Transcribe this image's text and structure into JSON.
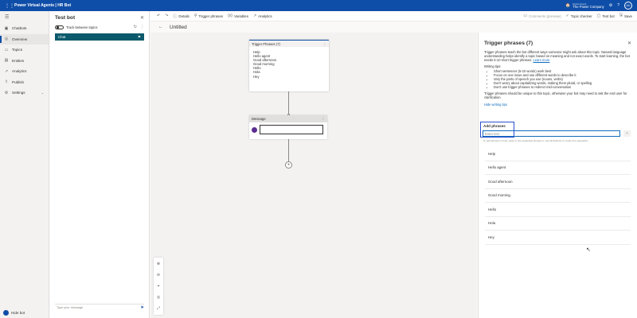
{
  "header": {
    "app_title": "Power Virtual Agents | HR Bot",
    "env_label": "Environment",
    "env_name": "The Power Company",
    "user_initials": "AU"
  },
  "nav": {
    "items": [
      {
        "label": "Chatbots",
        "icon": "bot-icon"
      },
      {
        "label": "Overview",
        "icon": "overview-icon",
        "active": true
      },
      {
        "label": "Topics",
        "icon": "topics-icon"
      },
      {
        "label": "Entities",
        "icon": "entities-icon"
      },
      {
        "label": "Analytics",
        "icon": "analytics-icon"
      },
      {
        "label": "Publish",
        "icon": "publish-icon"
      },
      {
        "label": "Settings",
        "icon": "settings-icon"
      }
    ],
    "hide_bot": "Hide bot"
  },
  "test_panel": {
    "title": "Test bot",
    "track_label": "Track between topics",
    "chat_label": "Chat",
    "input_placeholder": "Type your message"
  },
  "toolbar": {
    "details": "Details",
    "trigger_phrases": "Trigger phrases",
    "variables": "Variables",
    "analytics": "Analytics",
    "comments": "Comments (preview)",
    "topic_checker": "Topic checker",
    "test_bot": "Test bot",
    "save": "Save"
  },
  "canvas": {
    "title": "Untitled",
    "trigger_card_title": "Trigger Phrases (7)",
    "trigger_phrases": [
      "Help",
      "Hello agent",
      "Good afternoon",
      "Good morning",
      "Hello",
      "Hola",
      "Hey"
    ],
    "message_card_title": "Message"
  },
  "right_panel": {
    "title": "Trigger phrases (7)",
    "description": "Trigger phrases teach the bot different ways someone might ask about this topic. Natural language understanding helps identify a topic based on meaning and not exact words. To start learning, the bot needs 5-10 short trigger phrases.",
    "learn_more": "Learn more",
    "tips_heading": "Writing tips:",
    "tips": [
      "Short sentences (5-10 words) work best",
      "Focus on one issue and use different words to describe it",
      "Vary the parts of speech you use (nouns, verbs)",
      "Don't worry about capitalizing words, making them plural, or spelling",
      "Don't use trigger phrases to redirect mid-conversation"
    ],
    "unique_note": "Trigger phrases should be unique to this topic, otherwise your bot may need to ask the end user for clarification.",
    "hide_tips": "Hide writing tips",
    "add_label": "Add phrases",
    "add_placeholder": "Enter text",
    "add_hint": "To add phrases in bulk, paste in line-separated phrases or use Shift+Enter to create line separation.",
    "phrases": [
      "Help",
      "Hello agent",
      "Good afternoon",
      "Good morning",
      "Hello",
      "Hola",
      "Hey"
    ]
  },
  "colors": {
    "brand": "#0f4ea8",
    "chat_bar": "#0b5a6b",
    "highlight_box": "#2b4fcf"
  }
}
